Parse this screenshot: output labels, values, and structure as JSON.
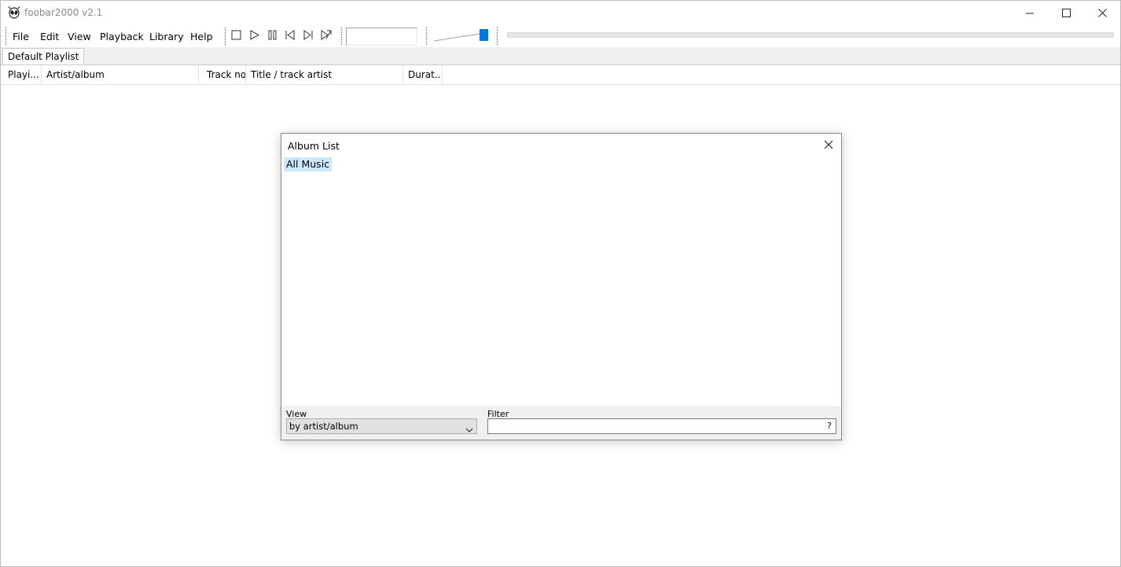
{
  "window": {
    "title": "foobar2000 v2.1"
  },
  "menu": [
    "File",
    "Edit",
    "View",
    "Playback",
    "Library",
    "Help"
  ],
  "toolbar": {
    "buttons": [
      "stop",
      "play",
      "pause",
      "previous",
      "next",
      "random"
    ],
    "volume_level": 1.0
  },
  "tabs": [
    {
      "label": "Default Playlist",
      "active": true
    }
  ],
  "playlist_columns": [
    "Playi...",
    "Artist/album",
    "Track no",
    "Title / track artist",
    "Durat..."
  ],
  "dialog": {
    "title": "Album List",
    "tree_items": [
      "All Music"
    ],
    "view_label": "View",
    "view_value": "by artist/album",
    "filter_label": "Filter",
    "filter_value": "",
    "filter_help": "?"
  },
  "colors": {
    "accent": "#0078d7",
    "selection": "#cce8ff"
  }
}
